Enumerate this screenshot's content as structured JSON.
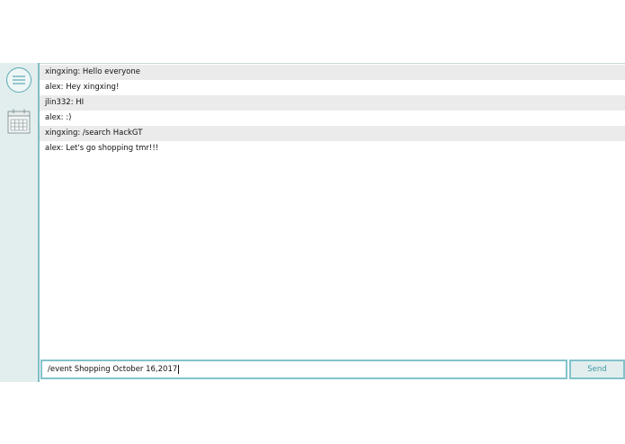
{
  "sidebar": {
    "menu_icon": "hamburger-menu-icon",
    "calendar_icon": "calendar-icon"
  },
  "messages": [
    {
      "text": "xingxing: Hello everyone"
    },
    {
      "text": "alex: Hey xingxing!"
    },
    {
      "text": "jlin332: HI"
    },
    {
      "text": "alex: :)"
    },
    {
      "text": "xingxing: /search HackGT"
    },
    {
      "text": "alex: Let's go shopping tmr!!!"
    }
  ],
  "composer": {
    "input_value": "/event Shopping October 16,2017",
    "send_label": "Send"
  },
  "colors": {
    "accent": "#82c2cb",
    "sidebar_bg": "#e2eeee",
    "alt_row": "#ebebeb",
    "send_text": "#3f95a3"
  }
}
